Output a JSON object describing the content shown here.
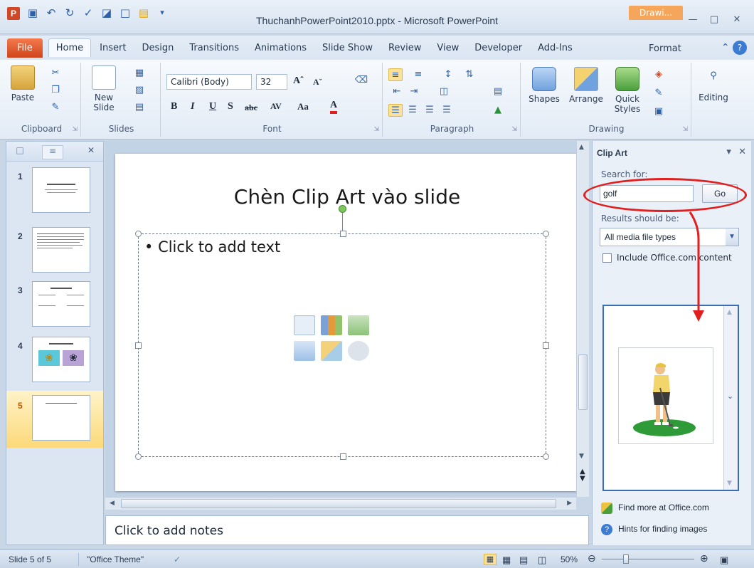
{
  "window": {
    "title": "ThuchanhPowerPoint2010.pptx  -  Microsoft PowerPoint",
    "context_tab": "Drawi...",
    "context_color": "#f6a65a"
  },
  "tabs": {
    "file": "File",
    "items": [
      "Home",
      "Insert",
      "Design",
      "Transitions",
      "Animations",
      "Slide Show",
      "Review",
      "View",
      "Developer",
      "Add-Ins"
    ],
    "format": "Format"
  },
  "ribbon": {
    "clipboard": {
      "label": "Clipboard",
      "paste": "Paste"
    },
    "slides": {
      "label": "Slides",
      "new_slide": "New Slide"
    },
    "font": {
      "label": "Font",
      "font_name": "Calibri (Body)",
      "font_size": "32"
    },
    "paragraph": {
      "label": "Paragraph"
    },
    "drawing": {
      "label": "Drawing",
      "shapes": "Shapes",
      "arrange": "Arrange",
      "quick_styles": "Quick Styles"
    },
    "editing": {
      "label": "Editing"
    }
  },
  "slides_pane": {
    "thumbnails": [
      {
        "number": "1"
      },
      {
        "number": "2"
      },
      {
        "number": "3"
      },
      {
        "number": "4"
      },
      {
        "number": "5"
      }
    ]
  },
  "slide": {
    "title": "Chèn Clip Art vào slide",
    "body_placeholder": "Click to add text"
  },
  "notes": {
    "placeholder": "Click to add notes"
  },
  "clip_art": {
    "title": "Clip Art",
    "search_label": "Search for:",
    "search_value": "golf",
    "go_button": "Go",
    "results_label": "Results should be:",
    "media_type": "All media file types",
    "include_office": "Include Office.com content",
    "find_more": "Find more at Office.com",
    "hints": "Hints for finding images"
  },
  "status": {
    "slide_info": "Slide 5 of 5",
    "theme": "\"Office Theme\"",
    "zoom": "50%"
  },
  "colors": {
    "annotation": "#e02020",
    "file_tab": "#d0441b",
    "selection": "#fcd97a"
  }
}
